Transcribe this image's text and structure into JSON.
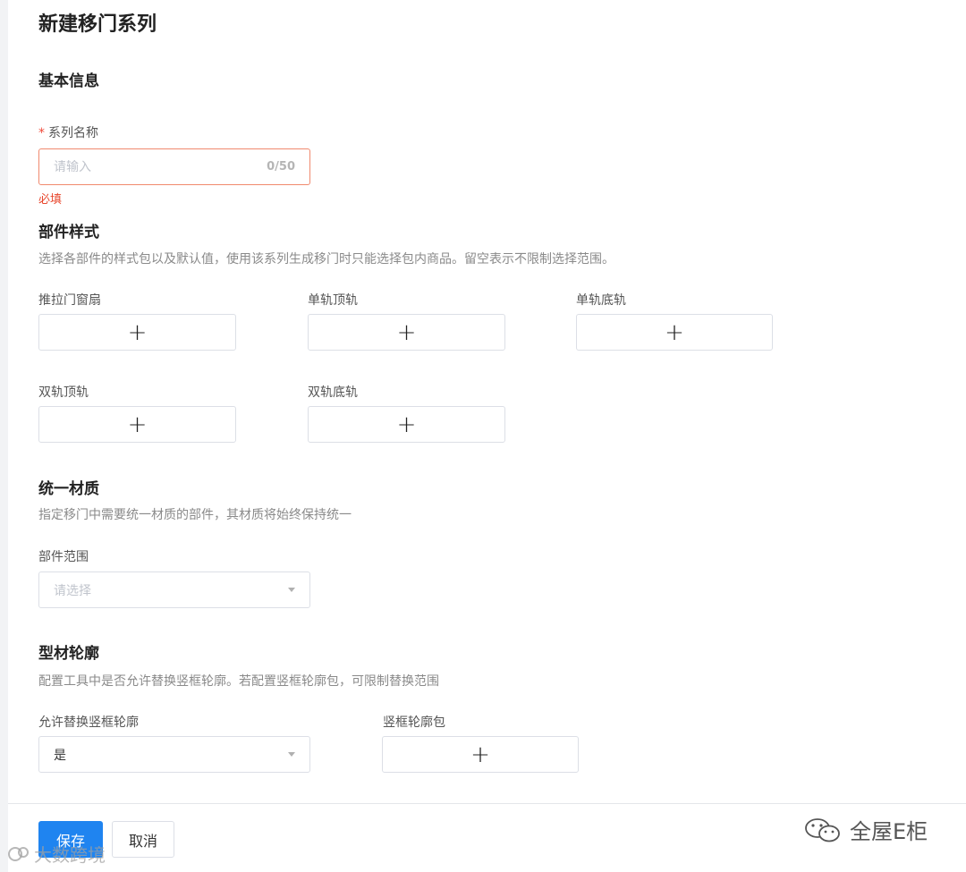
{
  "page": {
    "title": "新建移门系列"
  },
  "basic": {
    "title": "基本信息",
    "name_label": "系列名称",
    "required_star": "*",
    "name_placeholder": "请输入",
    "name_counter": "0/50",
    "error": "必填"
  },
  "parts": {
    "title": "部件样式",
    "desc": "选择各部件的样式包以及默认值，使用该系列生成移门时只能选择包内商品。留空表示不限制选择范围。",
    "items": [
      {
        "label": "推拉门窗扇"
      },
      {
        "label": "单轨顶轨"
      },
      {
        "label": "单轨底轨"
      },
      {
        "label": "双轨顶轨"
      },
      {
        "label": "双轨底轨"
      }
    ],
    "add_symbol": "+"
  },
  "material": {
    "title": "统一材质",
    "desc": "指定移门中需要统一材质的部件，其材质将始终保持统一",
    "range_label": "部件范围",
    "range_placeholder": "请选择"
  },
  "profile": {
    "title": "型材轮廓",
    "desc": "配置工具中是否允许替换竖框轮廓。若配置竖框轮廓包，可限制替换范围",
    "allow_label": "允许替换竖框轮廓",
    "allow_value": "是",
    "package_label": "竖框轮廓包",
    "add_symbol": "+"
  },
  "footer": {
    "save_label": "保存",
    "cancel_label": "取消"
  },
  "watermarks": {
    "left": "大数跨境",
    "right": "全屋E柜"
  },
  "colors": {
    "primary": "#1f84f0",
    "error": "#e8482e",
    "error_border": "#f0896e"
  }
}
